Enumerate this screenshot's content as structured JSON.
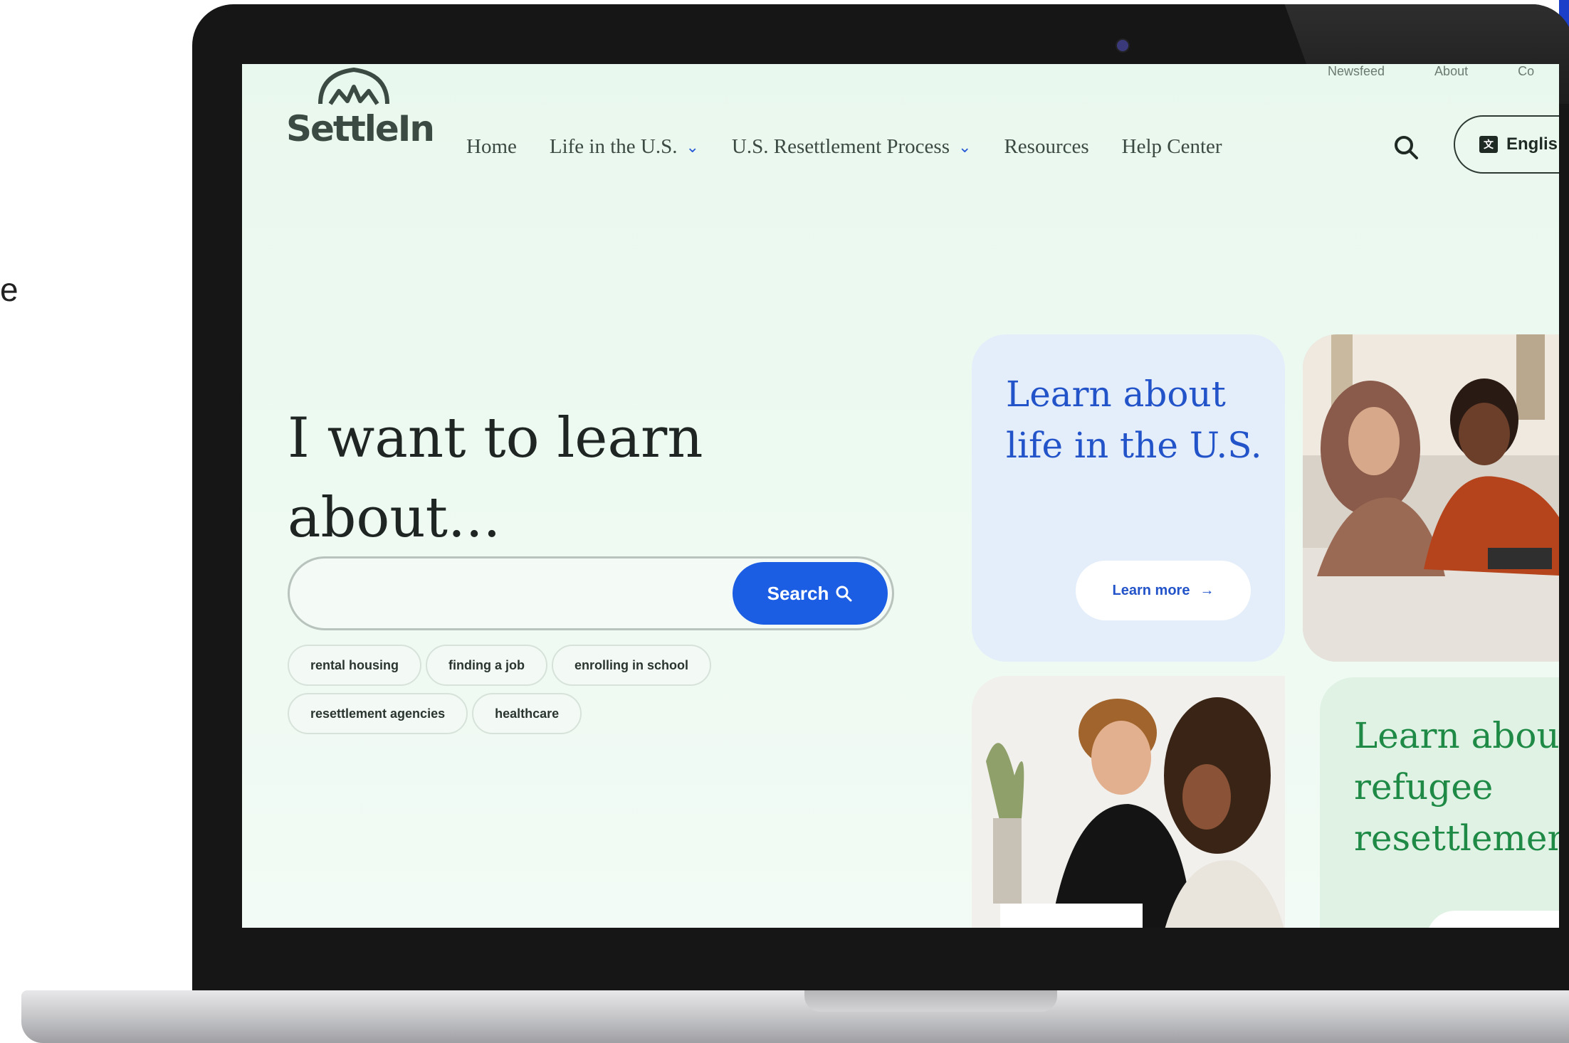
{
  "page": {
    "stray_letter": "e"
  },
  "site": {
    "logo_text": "SettleIn",
    "top_links": [
      "Newsfeed",
      "About",
      "Co"
    ],
    "nav": [
      {
        "label": "Home",
        "has_dropdown": false
      },
      {
        "label": "Life in the U.S.",
        "has_dropdown": true
      },
      {
        "label": "U.S. Resettlement Process",
        "has_dropdown": true
      },
      {
        "label": "Resources",
        "has_dropdown": false
      },
      {
        "label": "Help Center",
        "has_dropdown": false
      }
    ],
    "language_label": "Englis"
  },
  "hero": {
    "headline": "I want to learn about...",
    "search_value": "",
    "search_button": "Search",
    "chips_row1": [
      "rental housing",
      "finding a job",
      "enrolling in school"
    ],
    "chips_row2": [
      "resettlement agencies",
      "healthcare"
    ]
  },
  "cards": {
    "life": {
      "title": "Learn about life in the U.S.",
      "button": "Learn more"
    },
    "resettlement": {
      "title_lines": [
        "Learn about",
        "refugee",
        "resettlemen"
      ]
    }
  },
  "colors": {
    "accent_blue": "#1b5ee3",
    "card_blue_bg": "#e4eefa",
    "card_green_bg": "#dff2e4",
    "card_green_text": "#1f8a46",
    "screen_bg": "#e9f8ee"
  }
}
